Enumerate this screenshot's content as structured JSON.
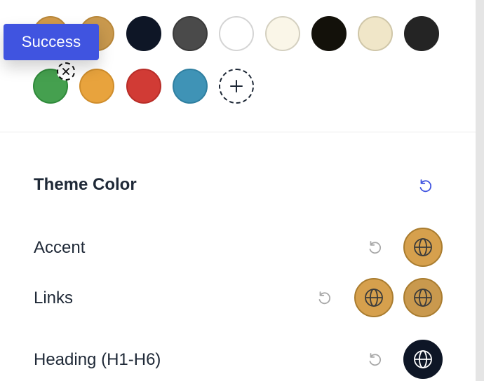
{
  "toast": {
    "label": "Success"
  },
  "palette": {
    "row1": [
      {
        "name": "tan",
        "color": "#d19a4a",
        "border": "#b8873a"
      },
      {
        "name": "gold",
        "color": "#c9994e",
        "border": "#b8873a"
      },
      {
        "name": "navy",
        "color": "#0e1626",
        "border": "#0e1626"
      },
      {
        "name": "dark-gray",
        "color": "#4a4a4a",
        "border": "#3a3a3a"
      },
      {
        "name": "white",
        "color": "#ffffff",
        "border": "#d4d4d4"
      },
      {
        "name": "ivory",
        "color": "#faf6e8",
        "border": "#d4d0c0"
      },
      {
        "name": "black-olive",
        "color": "#13110a",
        "border": "#13110a"
      },
      {
        "name": "cream",
        "color": "#f0e6c8",
        "border": "#cfc6a8"
      },
      {
        "name": "charcoal",
        "color": "#242424",
        "border": "#242424"
      }
    ],
    "row2": [
      {
        "name": "green",
        "color": "#45a04f",
        "border": "#2f8a3a"
      },
      {
        "name": "orange",
        "color": "#e8a33d",
        "border": "#cf8d2c"
      },
      {
        "name": "red",
        "color": "#d13b35",
        "border": "#b82d28"
      },
      {
        "name": "teal",
        "color": "#3f93b6",
        "border": "#2f7fa0"
      }
    ]
  },
  "theme": {
    "title": "Theme Color",
    "reset_color": "#4054e0",
    "rows": [
      {
        "label": "Accent",
        "swatches": [
          "#d6a04d"
        ]
      },
      {
        "label": "Links",
        "swatches": [
          "#d6a04d",
          "#c9994e"
        ]
      },
      {
        "label": "Heading (H1-H6)",
        "swatches": [
          "#0e1626"
        ]
      }
    ]
  }
}
